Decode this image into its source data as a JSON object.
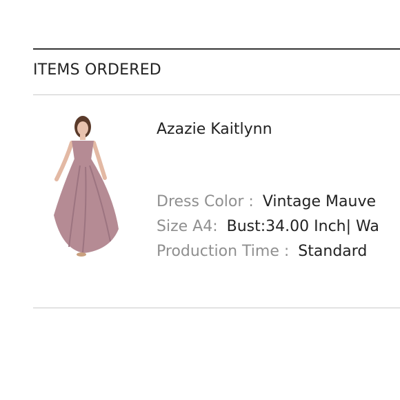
{
  "section": {
    "title": "ITEMS ORDERED"
  },
  "item": {
    "name": "Azazie Kaitlynn",
    "image_alt": "mauve off-shoulder chiffon gown",
    "attributes": [
      {
        "label": "Dress Color :",
        "value": "Vintage Mauve"
      },
      {
        "label": "Size A4:",
        "value": "Bust:34.00 Inch| Wa"
      },
      {
        "label": "Production Time :",
        "value": "Standard"
      }
    ]
  },
  "colors": {
    "dress": "#b58b94",
    "dress_shadow": "#9c7480",
    "label_gray": "#8f8f8f"
  }
}
